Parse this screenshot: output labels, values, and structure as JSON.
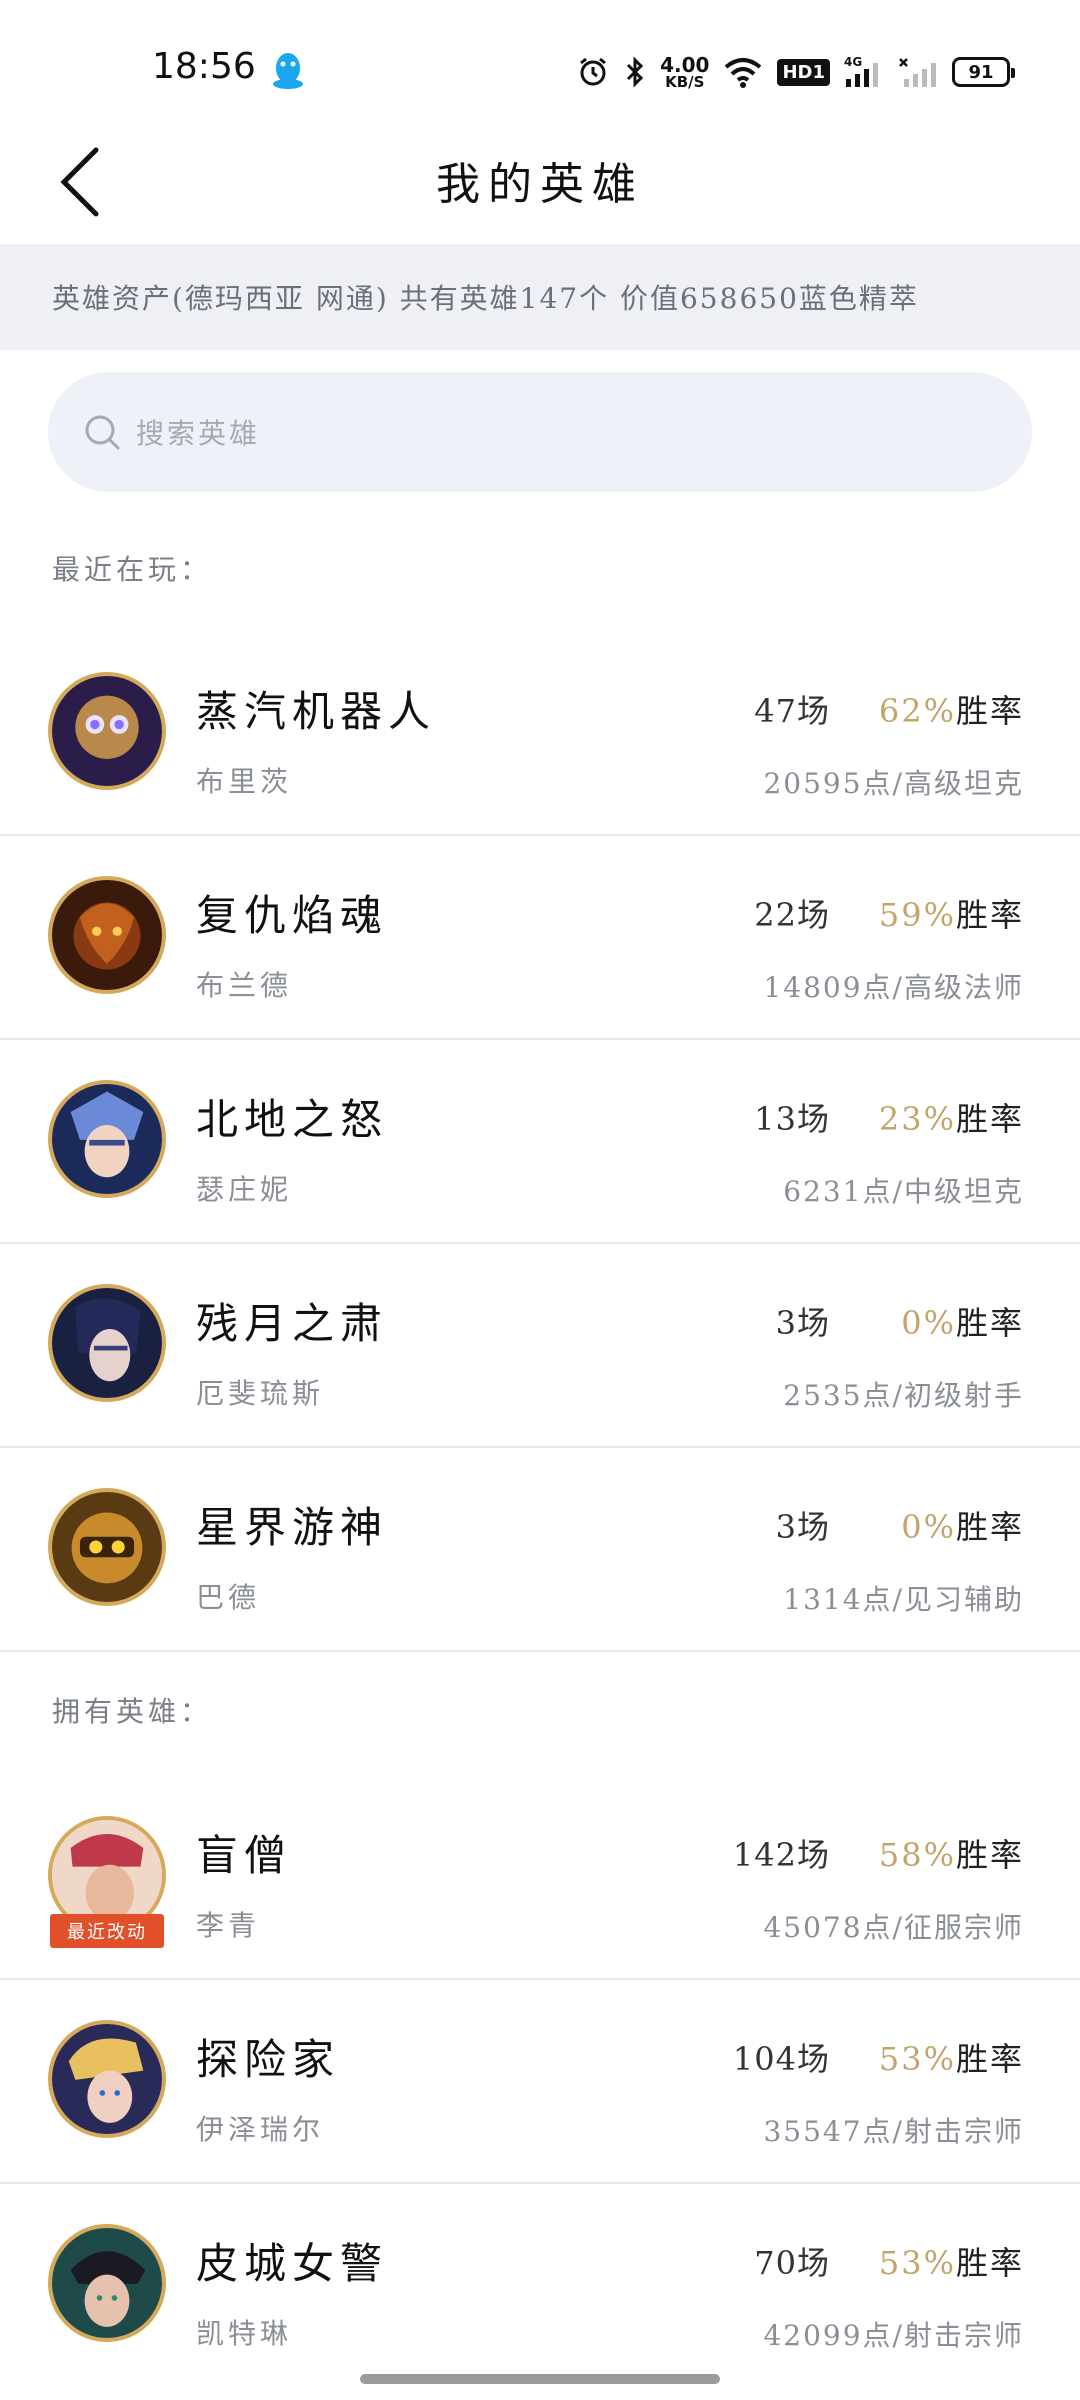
{
  "status_bar": {
    "time": "18:56",
    "net_speed_value": "4.00",
    "net_speed_unit": "KB/S",
    "hd_label": "HD1",
    "network_label": "4G",
    "battery": "91"
  },
  "header": {
    "title": "我的英雄"
  },
  "asset_banner": "英雄资产(德玛西亚 网通) 共有英雄147个 价值658650蓝色精萃",
  "search": {
    "placeholder": "搜索英雄"
  },
  "recent_section": {
    "label": "最近在玩："
  },
  "owned_section": {
    "label": "拥有英雄："
  },
  "rate_suffix": "胜率",
  "recent_tag": "最近改动",
  "recent_heroes": [
    {
      "name": "蒸汽机器人",
      "sub": "布里茨",
      "games": "47场",
      "rate": "62%",
      "points": "20595点/高级坦克",
      "icon": "blitzcrank-avatar"
    },
    {
      "name": "复仇焰魂",
      "sub": "布兰德",
      "games": "22场",
      "rate": "59%",
      "points": "14809点/高级法师",
      "icon": "brand-avatar"
    },
    {
      "name": "北地之怒",
      "sub": "瑟庄妮",
      "games": "13场",
      "rate": "23%",
      "points": "6231点/中级坦克",
      "icon": "sejuani-avatar"
    },
    {
      "name": "残月之肃",
      "sub": "厄斐琉斯",
      "games": "3场",
      "rate": "0%",
      "points": "2535点/初级射手",
      "icon": "aphelios-avatar"
    },
    {
      "name": "星界游神",
      "sub": "巴德",
      "games": "3场",
      "rate": "0%",
      "points": "1314点/见习辅助",
      "icon": "bard-avatar"
    }
  ],
  "owned_heroes": [
    {
      "name": "盲僧",
      "sub": "李青",
      "games": "142场",
      "rate": "58%",
      "points": "45078点/征服宗师",
      "icon": "leesin-avatar"
    },
    {
      "name": "探险家",
      "sub": "伊泽瑞尔",
      "games": "104场",
      "rate": "53%",
      "points": "35547点/射击宗师",
      "icon": "ezreal-avatar"
    },
    {
      "name": "皮城女警",
      "sub": "凯特琳",
      "games": "70场",
      "rate": "53%",
      "points": "42099点/射击宗师",
      "icon": "caitlyn-avatar"
    }
  ],
  "colors": {
    "accent_rate": "#c4a46a",
    "avatar_border": "#d6a95a",
    "recent_tag": "#e0502a",
    "banner_bg": "#eef0f6",
    "search_bg": "#eef2f8"
  }
}
